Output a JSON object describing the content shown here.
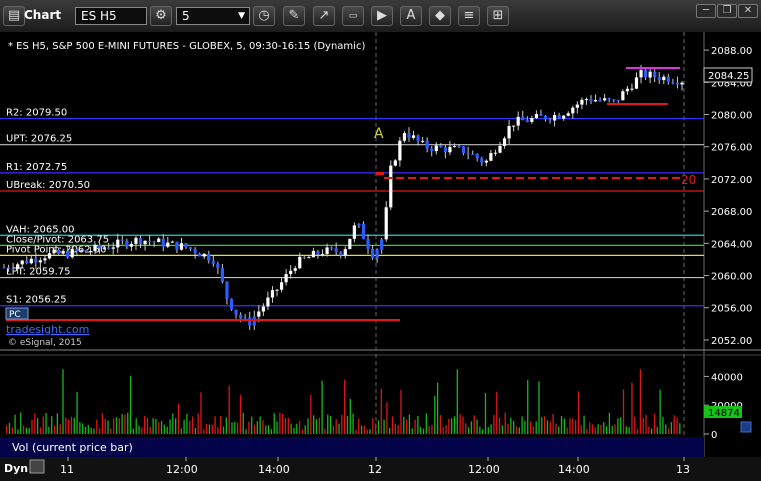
{
  "app": {
    "title": "Chart"
  },
  "toolbar": {
    "symbol": "ES H5",
    "interval": "5",
    "icons": [
      "symbol-search-icon",
      "settings-icon",
      "clock-icon",
      "pencil-icon",
      "cursor-icon",
      "zoom-icon",
      "play-icon",
      "text-tool-icon",
      "fib-tool-icon",
      "studies-icon",
      "window-menu-icon"
    ]
  },
  "window_buttons": [
    "maximize-icon",
    "restore-icon",
    "close-icon"
  ],
  "header": {
    "line": "* ES H5, S&P 500 E-MINI FUTURES - GLOBEX, 5, 09:30-16:15 (Dynamic)"
  },
  "levels": [
    {
      "label": "R2: 2079.50",
      "value": 2079.5,
      "color": "#3232ff"
    },
    {
      "label": "UPT: 2076.25",
      "value": 2076.25,
      "color": "#c0c0c0"
    },
    {
      "label": "R1: 2072.75",
      "value": 2072.75,
      "color": "#3232ff"
    },
    {
      "label": "UBreak: 2070.50",
      "value": 2070.5,
      "color": "#e01818"
    },
    {
      "label": "VAH: 2065.00",
      "value": 2065.0,
      "color": "#20d0d0"
    },
    {
      "label": "Close/Pivot: 2063.75",
      "value": 2063.75,
      "color": "#30d030"
    },
    {
      "label": "Pivot Point: 2062.50",
      "value": 2062.5,
      "color": "#e0e040"
    },
    {
      "label": "LPT: 2059.75",
      "value": 2059.75,
      "color": "#c0c0c0"
    },
    {
      "label": "S1: 2056.25",
      "value": 2056.25,
      "color": "#3232ff"
    }
  ],
  "overlay": {
    "pc_tag": "PC",
    "brand": "tradesight.com",
    "copyright": "© eSignal, 2015",
    "last_price": "2084.25",
    "annotation_A": "A",
    "break_marker": "20"
  },
  "price_axis": [
    "2088.00",
    "2084.00",
    "2080.00",
    "2076.00",
    "2072.00",
    "2068.00",
    "2064.00",
    "2060.00",
    "2056.00",
    "2052.00"
  ],
  "volume": {
    "label": "Vol (current price bar)",
    "axis": [
      "40000",
      "20000",
      "0"
    ],
    "last": "14874"
  },
  "time_axis": [
    "11",
    "12:00",
    "14:00",
    "12",
    "12:00",
    "14:00",
    "13"
  ],
  "bottom": {
    "dyn": "Dyn"
  },
  "chart_data": {
    "type": "candlestick",
    "symbol": "ES H5",
    "ylim": [
      2051,
      2090
    ],
    "last_price": 2084.25,
    "segments": [
      {
        "t": 0,
        "p": 2061.0
      },
      {
        "t": 0.06,
        "p": 2062.5
      },
      {
        "t": 0.12,
        "p": 2063.0
      },
      {
        "t": 0.2,
        "p": 2064.5
      },
      {
        "t": 0.27,
        "p": 2063.5
      },
      {
        "t": 0.31,
        "p": 2062.0
      },
      {
        "t": 0.33,
        "p": 2057.0
      },
      {
        "t": 0.345,
        "p": 2055.0
      },
      {
        "t": 0.36,
        "p": 2054.0
      },
      {
        "t": 0.4,
        "p": 2058.0
      },
      {
        "t": 0.43,
        "p": 2061.5
      },
      {
        "t": 0.47,
        "p": 2063.0
      },
      {
        "t": 0.5,
        "p": 2063.0
      },
      {
        "t": 0.52,
        "p": 2066.5
      },
      {
        "t": 0.545,
        "p": 2062.5
      },
      {
        "t": 0.56,
        "p": 2065.0
      },
      {
        "t": 0.57,
        "p": 2073.0
      },
      {
        "t": 0.59,
        "p": 2078.0
      },
      {
        "t": 0.62,
        "p": 2076.0
      },
      {
        "t": 0.68,
        "p": 2075.5
      },
      {
        "t": 0.71,
        "p": 2074.0
      },
      {
        "t": 0.75,
        "p": 2079.0
      },
      {
        "t": 0.82,
        "p": 2080.0
      },
      {
        "t": 0.86,
        "p": 2082.0
      },
      {
        "t": 0.9,
        "p": 2081.5
      },
      {
        "t": 0.94,
        "p": 2085.0
      },
      {
        "t": 0.98,
        "p": 2084.5
      },
      {
        "t": 1.0,
        "p": 2084.25
      }
    ],
    "volume_max": 50000,
    "volume_ticks": [
      40000,
      20000,
      0
    ],
    "last_volume": 14874
  }
}
